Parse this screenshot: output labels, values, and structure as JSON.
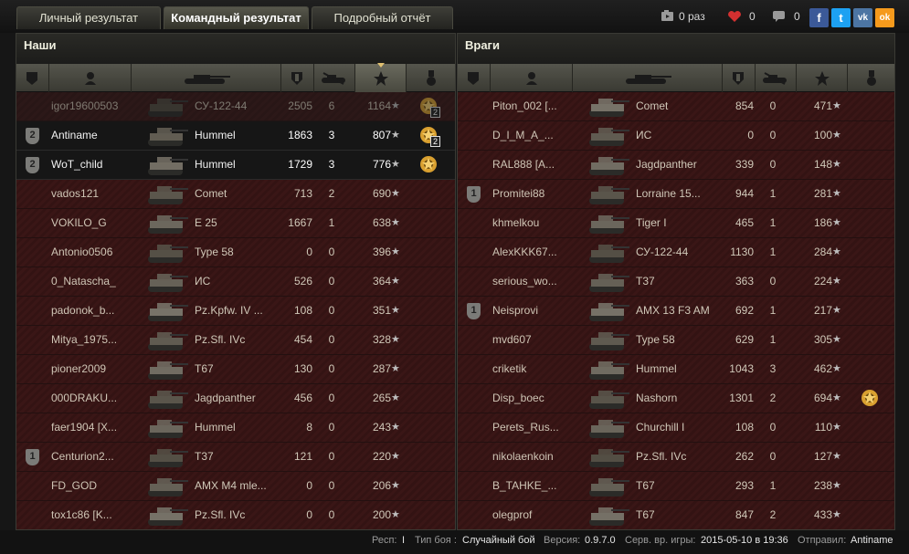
{
  "tabs": [
    {
      "label": "Личный результат"
    },
    {
      "label": "Командный результат"
    },
    {
      "label": "Подробный отчёт"
    }
  ],
  "header_stats": {
    "video_count": "0 раз",
    "likes": "0",
    "comments": "0"
  },
  "social": [
    "f",
    "t",
    "vk",
    "ok"
  ],
  "our_team": {
    "title": "Наши",
    "rows": [
      {
        "name": "igor19600503",
        "tank": "СУ-122-44",
        "damage": "2505",
        "kills": "6",
        "xp": "1164",
        "rank": "",
        "medal": true,
        "medal_count": "2",
        "style": "dead"
      },
      {
        "name": "Antiname",
        "tank": "Hummel",
        "damage": "1863",
        "kills": "3",
        "xp": "807",
        "rank": "2",
        "medal": true,
        "medal_count": "2",
        "style": "mine"
      },
      {
        "name": "WoT_child",
        "tank": "Hummel",
        "damage": "1729",
        "kills": "3",
        "xp": "776",
        "rank": "2",
        "medal": true,
        "medal_count": "",
        "style": "mine"
      },
      {
        "name": "vados121",
        "tank": "Comet",
        "damage": "713",
        "kills": "2",
        "xp": "690",
        "rank": "",
        "medal": false,
        "medal_count": "",
        "style": ""
      },
      {
        "name": "VOKILO_G",
        "tank": "E 25",
        "damage": "1667",
        "kills": "1",
        "xp": "638",
        "rank": "",
        "medal": false,
        "medal_count": "",
        "style": ""
      },
      {
        "name": "Antonio0506",
        "tank": "Type 58",
        "damage": "0",
        "kills": "0",
        "xp": "396",
        "rank": "",
        "medal": false,
        "medal_count": "",
        "style": ""
      },
      {
        "name": "0_Natascha_",
        "tank": "ИС",
        "damage": "526",
        "kills": "0",
        "xp": "364",
        "rank": "",
        "medal": false,
        "medal_count": "",
        "style": ""
      },
      {
        "name": "padonok_b...",
        "tank": "Pz.Kpfw. IV ...",
        "damage": "108",
        "kills": "0",
        "xp": "351",
        "rank": "",
        "medal": false,
        "medal_count": "",
        "style": ""
      },
      {
        "name": "Mitya_1975...",
        "tank": "Pz.Sfl. IVc",
        "damage": "454",
        "kills": "0",
        "xp": "328",
        "rank": "",
        "medal": false,
        "medal_count": "",
        "style": ""
      },
      {
        "name": "pioner2009",
        "tank": "T67",
        "damage": "130",
        "kills": "0",
        "xp": "287",
        "rank": "",
        "medal": false,
        "medal_count": "",
        "style": ""
      },
      {
        "name": "000DRAKU...",
        "tank": "Jagdpanther",
        "damage": "456",
        "kills": "0",
        "xp": "265",
        "rank": "",
        "medal": false,
        "medal_count": "",
        "style": ""
      },
      {
        "name": "faer1904 [X...",
        "tank": "Hummel",
        "damage": "8",
        "kills": "0",
        "xp": "243",
        "rank": "",
        "medal": false,
        "medal_count": "",
        "style": ""
      },
      {
        "name": "Centurion2...",
        "tank": "T37",
        "damage": "121",
        "kills": "0",
        "xp": "220",
        "rank": "1",
        "medal": false,
        "medal_count": "",
        "style": ""
      },
      {
        "name": "FD_GOD",
        "tank": "AMX M4 mle...",
        "damage": "0",
        "kills": "0",
        "xp": "206",
        "rank": "",
        "medal": false,
        "medal_count": "",
        "style": ""
      },
      {
        "name": "tox1c86 [K...",
        "tank": "Pz.Sfl. IVc",
        "damage": "0",
        "kills": "0",
        "xp": "200",
        "rank": "",
        "medal": false,
        "medal_count": "",
        "style": ""
      }
    ]
  },
  "enemy_team": {
    "title": "Враги",
    "rows": [
      {
        "name": "Piton_002 [...",
        "tank": "Comet",
        "damage": "854",
        "kills": "0",
        "xp": "471",
        "rank": "",
        "medal": false,
        "medal_count": "",
        "style": ""
      },
      {
        "name": "D_I_M_A_...",
        "tank": "ИС",
        "damage": "0",
        "kills": "0",
        "xp": "100",
        "rank": "",
        "medal": false,
        "medal_count": "",
        "style": ""
      },
      {
        "name": "RAL888 [A...",
        "tank": "Jagdpanther",
        "damage": "339",
        "kills": "0",
        "xp": "148",
        "rank": "",
        "medal": false,
        "medal_count": "",
        "style": ""
      },
      {
        "name": "Promitei88",
        "tank": "Lorraine 15...",
        "damage": "944",
        "kills": "1",
        "xp": "281",
        "rank": "1",
        "medal": false,
        "medal_count": "",
        "style": ""
      },
      {
        "name": "khmelkou",
        "tank": "Tiger I",
        "damage": "465",
        "kills": "1",
        "xp": "186",
        "rank": "",
        "medal": false,
        "medal_count": "",
        "style": ""
      },
      {
        "name": "AlexKKK67...",
        "tank": "СУ-122-44",
        "damage": "1130",
        "kills": "1",
        "xp": "284",
        "rank": "",
        "medal": false,
        "medal_count": "",
        "style": ""
      },
      {
        "name": "serious_wo...",
        "tank": "T37",
        "damage": "363",
        "kills": "0",
        "xp": "224",
        "rank": "",
        "medal": false,
        "medal_count": "",
        "style": ""
      },
      {
        "name": "Neisprovi",
        "tank": "AMX 13 F3 AM",
        "damage": "692",
        "kills": "1",
        "xp": "217",
        "rank": "1",
        "medal": false,
        "medal_count": "",
        "style": ""
      },
      {
        "name": "mvd607",
        "tank": "Type 58",
        "damage": "629",
        "kills": "1",
        "xp": "305",
        "rank": "",
        "medal": false,
        "medal_count": "",
        "style": ""
      },
      {
        "name": "criketik",
        "tank": "Hummel",
        "damage": "1043",
        "kills": "3",
        "xp": "462",
        "rank": "",
        "medal": false,
        "medal_count": "",
        "style": ""
      },
      {
        "name": "Disp_boec",
        "tank": "Nashorn",
        "damage": "1301",
        "kills": "2",
        "xp": "694",
        "rank": "",
        "medal": true,
        "medal_count": "",
        "style": ""
      },
      {
        "name": "Perets_Rus...",
        "tank": "Churchill I",
        "damage": "108",
        "kills": "0",
        "xp": "110",
        "rank": "",
        "medal": false,
        "medal_count": "",
        "style": ""
      },
      {
        "name": "nikolaenkoin",
        "tank": "Pz.Sfl. IVc",
        "damage": "262",
        "kills": "0",
        "xp": "127",
        "rank": "",
        "medal": false,
        "medal_count": "",
        "style": ""
      },
      {
        "name": "B_TAHKE_...",
        "tank": "T67",
        "damage": "293",
        "kills": "1",
        "xp": "238",
        "rank": "",
        "medal": false,
        "medal_count": "",
        "style": ""
      },
      {
        "name": "olegprof",
        "tank": "T67",
        "damage": "847",
        "kills": "2",
        "xp": "433",
        "rank": "",
        "medal": false,
        "medal_count": "",
        "style": ""
      }
    ]
  },
  "footer": {
    "resp_label": "Респ:",
    "resp_value": "I",
    "type_label": "Тип боя :",
    "type_value": "Случайный бой",
    "version_label": "Версия:",
    "version_value": "0.9.7.0",
    "server_label": "Серв. вр. игры:",
    "server_value": "2015-05-10 в 19:36",
    "sender_label": "Отправил:",
    "sender_value": "Antiname"
  },
  "colors": {
    "row_bg": "#3a1616",
    "mine_bg": "#161616",
    "rank_badge": "#7b7b78",
    "medal_gold": "#d9a030",
    "star": "#bdbdbd"
  }
}
